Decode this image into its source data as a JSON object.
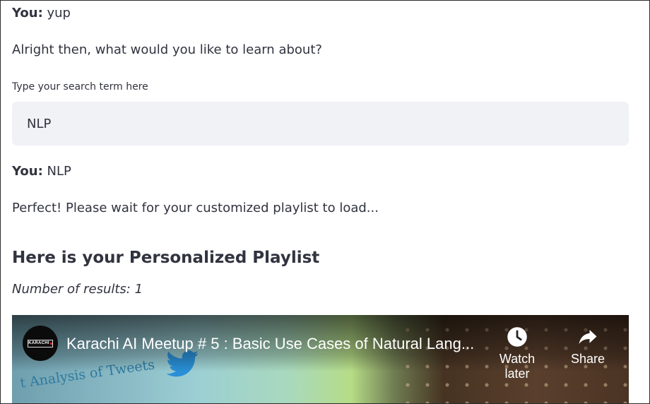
{
  "chat": {
    "msg1_speaker": "You:",
    "msg1_text": " yup",
    "bot_prompt": "Alright then, what would you like to learn about?",
    "msg2_speaker": "You:",
    "msg2_text": " NLP",
    "bot_wait": "Perfect! Please wait for your customized playlist to load..."
  },
  "search": {
    "label": "Type your search term here",
    "value": "NLP"
  },
  "playlist": {
    "heading": "Here is your Personalized Playlist",
    "results_label": "Number of results: 1"
  },
  "video": {
    "title": "Karachi AI Meetup # 5 : Basic Use Cases of Natural Lang...",
    "channel_logo_text": "KARACHI",
    "slide_text": "t Analysis of Tweets",
    "watch_later_label": "Watch later",
    "share_label": "Share",
    "icons": {
      "watch_later": "clock-icon",
      "share": "share-arrow-icon",
      "bird": "twitter-bird-icon"
    }
  },
  "colors": {
    "input_bg": "#f0f2f6",
    "text": "#31333f"
  }
}
